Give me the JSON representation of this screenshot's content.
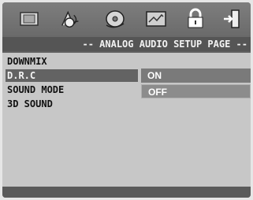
{
  "header": {
    "icons": [
      {
        "name": "general-setup-icon",
        "selected": false
      },
      {
        "name": "audio-setup-icon",
        "selected": true
      },
      {
        "name": "disc-setup-icon",
        "selected": false
      },
      {
        "name": "video-setup-icon",
        "selected": false
      },
      {
        "name": "lock-icon",
        "selected": false
      },
      {
        "name": "exit-icon",
        "selected": false
      }
    ],
    "title": "-- ANALOG AUDIO SETUP PAGE --"
  },
  "menu": {
    "items": [
      {
        "label": "DOWNMIX"
      },
      {
        "label": "D.R.C"
      },
      {
        "label": "SOUND MODE"
      },
      {
        "label": "3D SOUND"
      }
    ],
    "selected_index": 1
  },
  "submenu": {
    "options": [
      {
        "label": "ON"
      },
      {
        "label": "OFF"
      }
    ],
    "highlighted_index": 1
  },
  "colors": {
    "panel": "#c7c7c7",
    "highlight": "#636363",
    "header": "#6a6a6a"
  }
}
